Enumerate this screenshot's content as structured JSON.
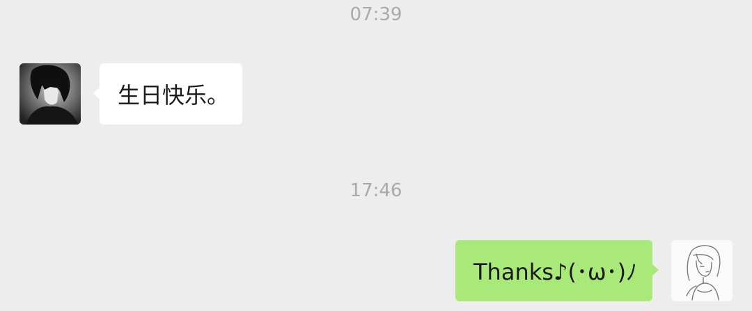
{
  "chat": {
    "messages": [
      {
        "timestamp": "07:39",
        "direction": "incoming",
        "text": "生日快乐。",
        "avatar_icon": "dark-haired-person-avatar"
      },
      {
        "timestamp": "17:46",
        "direction": "outgoing",
        "text": "Thanks♪(･ω･)ﾉ",
        "avatar_icon": "sketch-girl-avatar"
      }
    ]
  },
  "colors": {
    "background": "#ededed",
    "incoming_bubble": "#ffffff",
    "outgoing_bubble": "#a9e97a",
    "timestamp_text": "#a9a9a9",
    "message_text": "#1a1a1a"
  }
}
